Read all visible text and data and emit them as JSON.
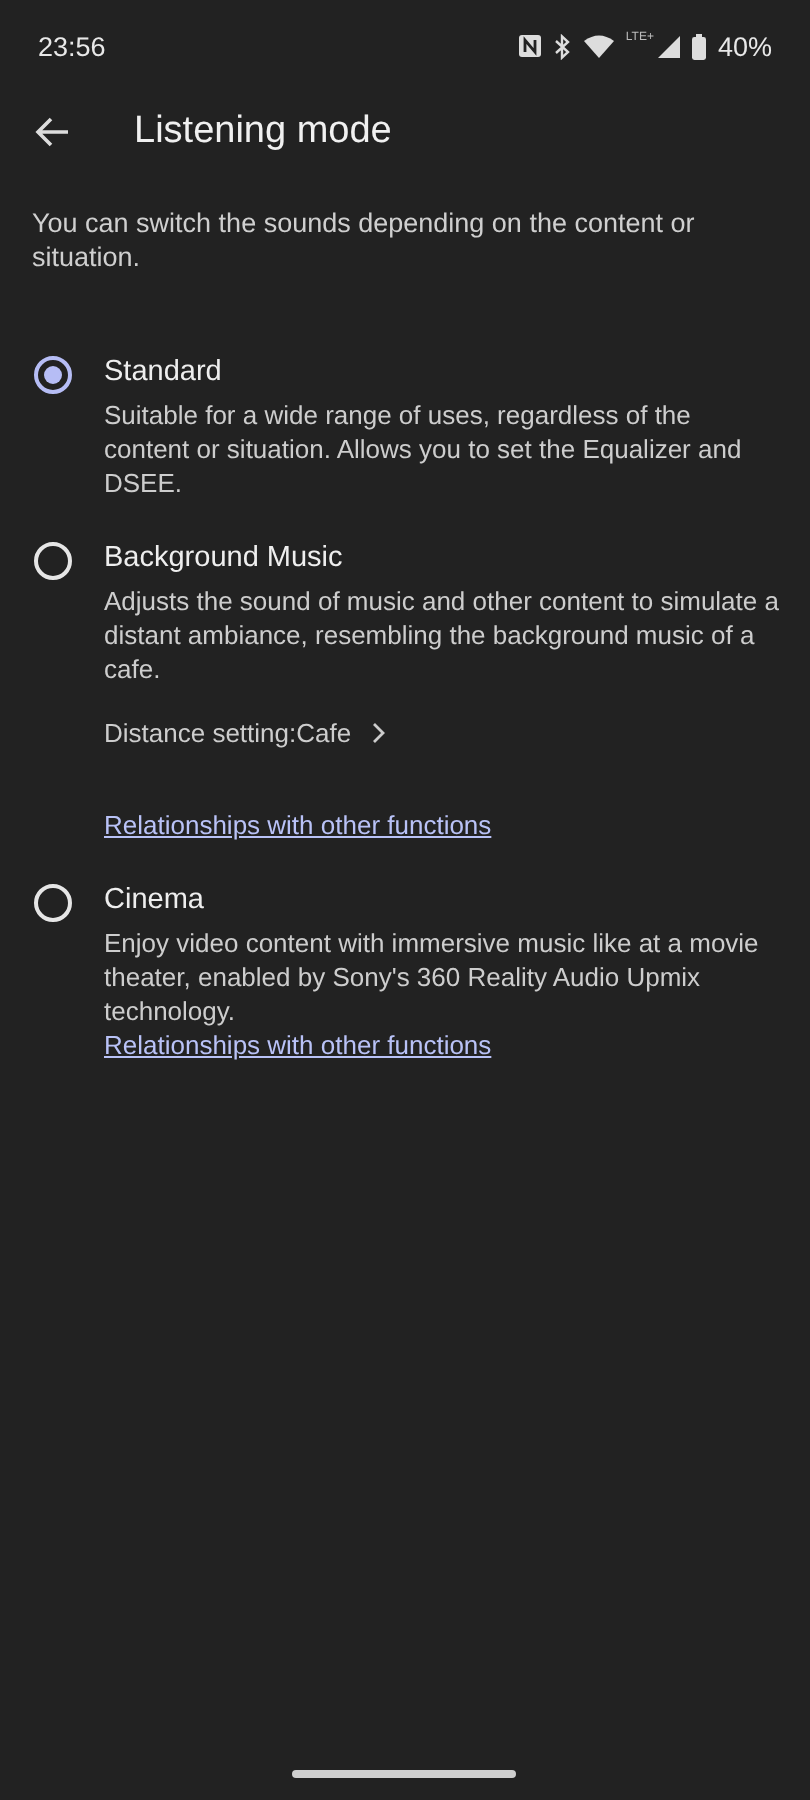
{
  "status_bar": {
    "time": "23:56",
    "network": "LTE+",
    "battery": "40%"
  },
  "header": {
    "title": "Listening mode"
  },
  "intro": "You can switch the sounds depending on the content or situation.",
  "options": [
    {
      "title": "Standard",
      "selected": true,
      "description": "Suitable for a wide range of uses, regardless of the content or situation. Allows you to set the Equalizer and DSEE."
    },
    {
      "title": "Background Music",
      "selected": false,
      "description": "Adjusts the sound of music and other content to simulate a distant ambiance, resembling the background music of a cafe.",
      "setting": "Distance setting:Cafe",
      "link": "Relationships with other functions"
    },
    {
      "title": "Cinema",
      "selected": false,
      "description": "Enjoy video content with immersive music like at a movie theater, enabled by Sony's 360 Reality Audio Upmix technology.",
      "link": "Relationships with other functions"
    }
  ]
}
